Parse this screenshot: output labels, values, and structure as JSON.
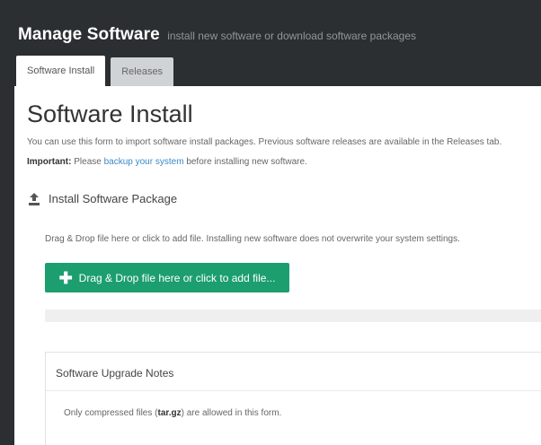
{
  "header": {
    "title": "Manage Software",
    "subtitle": "install new software or download software packages"
  },
  "tabs": [
    {
      "label": "Software Install",
      "active": true
    },
    {
      "label": "Releases",
      "active": false
    }
  ],
  "page": {
    "title": "Software Install",
    "description": "You can use this form to import software install packages. Previous software releases are available in the Releases tab.",
    "important_label": "Important:",
    "important_pre": "Please",
    "important_link": "backup your system",
    "important_post": "before installing new software."
  },
  "upload": {
    "section_title": "Install Software Package",
    "section_icon": "upload-icon",
    "hint": "Drag & Drop file here or click to add file. Installing new software does not overwrite your system settings.",
    "button_label": "Drag & Drop file here or click to add file...",
    "button_icon": "plus-icon",
    "progress_percent": 0
  },
  "notes": {
    "title": "Software Upgrade Notes",
    "text_pre": "Only compressed files (",
    "text_bold": "tar.gz",
    "text_post": ") are allowed in this form."
  },
  "colors": {
    "header_bg": "#2b2f32",
    "accent_green": "#1c9e6f",
    "link_blue": "#3b89c7"
  }
}
